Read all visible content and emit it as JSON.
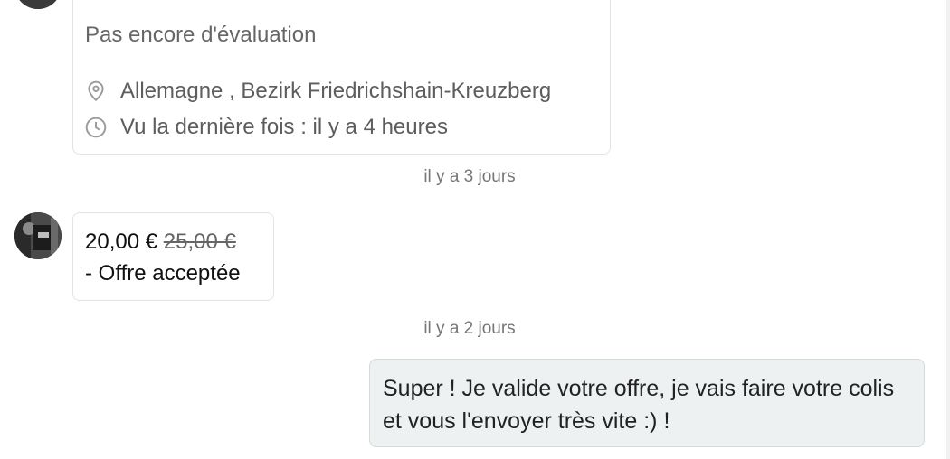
{
  "profile_card": {
    "rating_text": "Pas encore d'évaluation",
    "location_icon": "location-pin-icon",
    "location_text": "Allemagne , Bezirk Friedrichshain-Kreuzberg",
    "last_seen_icon": "clock-icon",
    "last_seen_text": "Vu la dernière fois : il y a 4 heures"
  },
  "timestamps": {
    "first": "il y a 3 jours",
    "second": "il y a 2 jours"
  },
  "offer_message": {
    "new_price": "20,00 €",
    "old_price": "25,00 €",
    "status": "- Offre acceptée"
  },
  "sent_message": {
    "text": "Super ! Je valide votre offre, je vais faire votre colis et vous l'envoyer très vite :) !"
  },
  "colors": {
    "sent_bubble_bg": "#eef1f1",
    "card_border": "#e3e3e3",
    "muted_text": "#5d5d5d"
  }
}
